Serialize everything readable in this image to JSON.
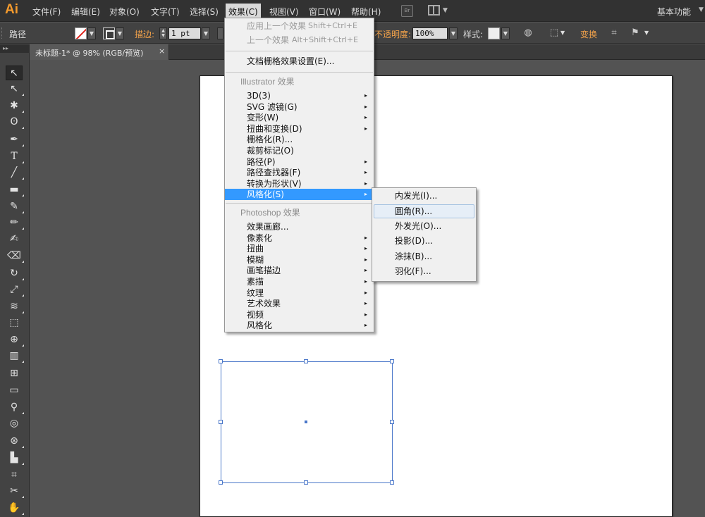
{
  "app": {
    "logo": "Ai"
  },
  "menubar": {
    "items": [
      "文件(F)",
      "编辑(E)",
      "对象(O)",
      "文字(T)",
      "选择(S)",
      "效果(C)",
      "视图(V)",
      "窗口(W)",
      "帮助(H)"
    ],
    "bridge_label": "Br",
    "workspace": "基本功能"
  },
  "control_bar": {
    "object_type": "路径",
    "stroke_label": "描边:",
    "stroke_weight": "1 pt",
    "opacity_label": "不透明度:",
    "opacity_value": "100%",
    "style_label": "样式:",
    "transform_label": "变换"
  },
  "document_tab": {
    "title": "未标题-1* @ 98% (RGB/预览)",
    "close": "×"
  },
  "tools": [
    "selection-tool",
    "direct-selection-tool",
    "magic-wand-tool",
    "lasso-tool",
    "pen-tool",
    "type-tool",
    "line-tool",
    "rectangle-tool",
    "paintbrush-tool",
    "pencil-tool",
    "blob-brush-tool",
    "eraser-tool",
    "rotate-tool",
    "scale-tool",
    "width-tool",
    "free-transform-tool",
    "shape-builder-tool",
    "perspective-grid-tool",
    "mesh-tool",
    "gradient-tool",
    "eyedropper-tool",
    "blend-tool",
    "symbol-sprayer-tool",
    "column-graph-tool",
    "artboard-tool",
    "slice-tool",
    "hand-tool"
  ],
  "effect_menu": {
    "apply_last": {
      "label": "应用上一个效果",
      "shortcut": "Shift+Ctrl+E"
    },
    "last_effect": {
      "label": "上一个效果",
      "shortcut": "Alt+Shift+Ctrl+E"
    },
    "doc_raster": "文档栅格效果设置(E)...",
    "illustrator_header": "Illustrator 效果",
    "illustrator_items": [
      {
        "label": "3D(3)",
        "submenu": true
      },
      {
        "label": "SVG 滤镜(G)",
        "submenu": true
      },
      {
        "label": "变形(W)",
        "submenu": true
      },
      {
        "label": "扭曲和变换(D)",
        "submenu": true
      },
      {
        "label": "栅格化(R)...",
        "submenu": false
      },
      {
        "label": "裁剪标记(O)",
        "submenu": false
      },
      {
        "label": "路径(P)",
        "submenu": true
      },
      {
        "label": "路径查找器(F)",
        "submenu": true
      },
      {
        "label": "转换为形状(V)",
        "submenu": true
      },
      {
        "label": "风格化(S)",
        "submenu": true
      }
    ],
    "photoshop_header": "Photoshop 效果",
    "photoshop_items": [
      {
        "label": "效果画廊...",
        "submenu": false
      },
      {
        "label": "像素化",
        "submenu": true
      },
      {
        "label": "扭曲",
        "submenu": true
      },
      {
        "label": "模糊",
        "submenu": true
      },
      {
        "label": "画笔描边",
        "submenu": true
      },
      {
        "label": "素描",
        "submenu": true
      },
      {
        "label": "纹理",
        "submenu": true
      },
      {
        "label": "艺术效果",
        "submenu": true
      },
      {
        "label": "视频",
        "submenu": true
      },
      {
        "label": "风格化",
        "submenu": true
      }
    ]
  },
  "stylize_submenu": {
    "items": [
      "内发光(I)...",
      "圆角(R)...",
      "外发光(O)...",
      "投影(D)...",
      "涂抹(B)...",
      "羽化(F)..."
    ]
  },
  "arrow_glyph": "▸",
  "colors": {
    "highlight": "#3399ff",
    "selection": "#4a77c9",
    "accent": "#f59b2d"
  }
}
